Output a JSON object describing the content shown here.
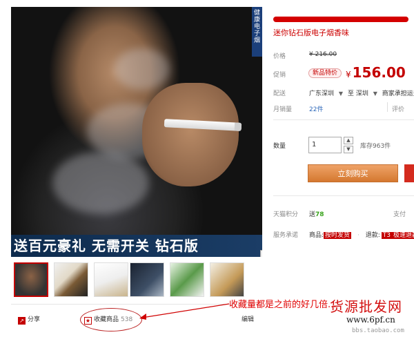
{
  "image": {
    "side_text": "健康电子烟",
    "banner": "送百元豪礼 无需开关 钻石版",
    "zoom_icon": "magnifier-icon"
  },
  "title": {
    "lines": [
      "迷你钻石版电子烟香味"
    ]
  },
  "price": {
    "label": "价格",
    "original": "¥ 216.00"
  },
  "promo": {
    "label": "促销",
    "badge": "新品特价",
    "yen": "¥",
    "amount": "156.00"
  },
  "shipping": {
    "label": "配送",
    "from": "广东深圳",
    "to_word": "至",
    "to": "深圳",
    "carrier_note": "商家承担运费"
  },
  "sales": {
    "label": "月销量",
    "count": "22件",
    "reviews_label": "评价"
  },
  "quantity": {
    "label": "数量",
    "value": "1",
    "stock": "库存963件"
  },
  "buy": {
    "label": "立刻购买"
  },
  "points": {
    "label": "天猫积分",
    "prefix": "送",
    "value": "78",
    "pay_label": "支付"
  },
  "promise": {
    "label": "服务承诺",
    "goods": "商品:",
    "tag1": "按时发货",
    "refund": "退款:",
    "tag2": "T3",
    "tag3": "极速退款"
  },
  "actions": {
    "share": "分享",
    "favorite": "收藏商品",
    "favorite_count": "538",
    "edit": "编辑"
  },
  "annotation": {
    "text": "收藏量都是之前的好几倍..."
  },
  "watermark": {
    "line1": "货源批发网",
    "line2": "www.6pf.cn",
    "line3": "bbs.taobao.com"
  },
  "colors": {
    "accent": "#c40000",
    "buy_button": "#e3935a",
    "link_blue": "#2a65b8",
    "points_green": "#3aa31d"
  }
}
